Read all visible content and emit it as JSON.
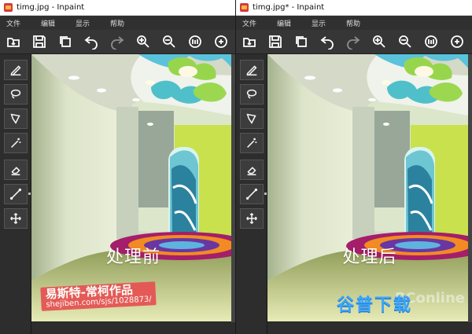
{
  "left": {
    "title": "timg.jpg - Inpaint",
    "menu": [
      "文件",
      "编辑",
      "显示",
      "帮助"
    ],
    "caption": "处理前",
    "watermark_line1": "易斯特-常柯作品",
    "watermark_line2": "shejiben.com/sjs/1028873/"
  },
  "right": {
    "title": "timg.jpg* - Inpaint",
    "menu": [
      "文件",
      "编辑",
      "显示",
      "帮助"
    ],
    "caption": "处理后",
    "pconline": "PConline",
    "brandmark": "谷普下载"
  },
  "toolbar_icons": [
    "open-icon",
    "save-icon",
    "copy-icon",
    "undo-icon",
    "redo-icon",
    "zoom-in-icon",
    "zoom-out-icon",
    "actual-size-icon",
    "fit-icon"
  ],
  "tool_icons": [
    "marker-icon",
    "lasso-icon",
    "polygon-lasso-icon",
    "magic-wand-icon",
    "eraser-icon",
    "line-icon",
    "move-icon"
  ],
  "colors": {
    "titlebar": "#ffffff",
    "menubar": "#303030",
    "toolbar": "#363636",
    "panel": "#2d2d2d",
    "watermark": "#e65353",
    "brand_blue": "#3aa6ff"
  }
}
